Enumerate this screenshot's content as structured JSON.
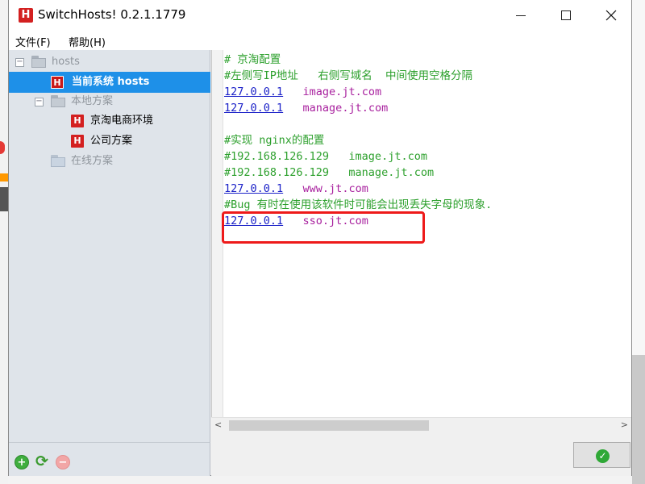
{
  "window": {
    "title": "SwitchHosts! 0.2.1.1779",
    "app_icon_letter": "H"
  },
  "menu": {
    "file": "文件(F)",
    "help": "帮助(H)"
  },
  "sidebar": {
    "root": {
      "label": "hosts",
      "toggle": "−"
    },
    "current": {
      "label": "当前系统 hosts",
      "icon": "H"
    },
    "local_group": {
      "label": "本地方案",
      "toggle": "−"
    },
    "local_items": [
      {
        "label": "京淘电商环境",
        "icon": "H"
      },
      {
        "label": "公司方案",
        "icon": "H"
      }
    ],
    "online_group": {
      "label": "在线方案"
    },
    "footer": {
      "add": "+",
      "refresh": "⟳",
      "remove": "−"
    }
  },
  "editor": {
    "lines": [
      {
        "type": "comment",
        "text": "# 京淘配置"
      },
      {
        "type": "comment",
        "text": "#左侧写IP地址   右侧写域名  中间使用空格分隔"
      },
      {
        "type": "entry",
        "ip": "127.0.0.1",
        "sep": "   ",
        "domain": "image.jt.com"
      },
      {
        "type": "entry",
        "ip": "127.0.0.1",
        "sep": "   ",
        "domain": "manage.jt.com"
      },
      {
        "type": "blank",
        "text": ""
      },
      {
        "type": "comment",
        "text": "#实现 nginx的配置"
      },
      {
        "type": "comment",
        "text": "#192.168.126.129   image.jt.com"
      },
      {
        "type": "comment",
        "text": "#192.168.126.129   manage.jt.com"
      },
      {
        "type": "entry",
        "ip": "127.0.0.1",
        "sep": "   ",
        "domain": "www.jt.com"
      },
      {
        "type": "comment",
        "text": "#Bug 有时在使用该软件时可能会出现丢失字母的现象."
      },
      {
        "type": "entry",
        "ip": "127.0.0.1",
        "sep": "   ",
        "domain": "sso.jt.com"
      }
    ]
  },
  "scrollbar": {
    "left_arrow": "<",
    "right_arrow": ">"
  },
  "ok_button": {
    "symbol": "✓"
  },
  "colors": {
    "comment": "#2da02d",
    "ip": "#1c22c8",
    "domain": "#a8209e",
    "selection": "#1e90e8",
    "highlight": "#ee1a1a"
  }
}
